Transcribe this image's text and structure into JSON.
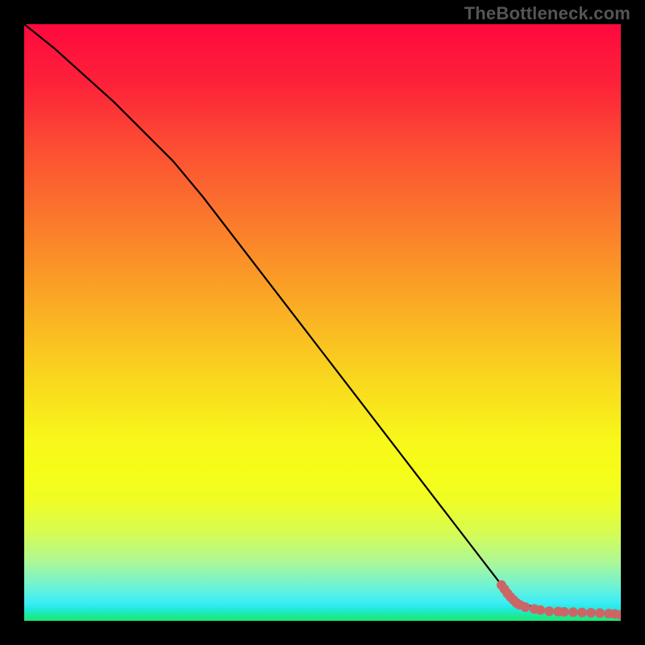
{
  "attribution": "TheBottleneck.com",
  "chart_data": {
    "type": "line",
    "title": "",
    "xlabel": "",
    "ylabel": "",
    "xlim": [
      0,
      100
    ],
    "ylim": [
      0,
      100
    ],
    "grid": false,
    "legend": false,
    "series": [
      {
        "name": "curve",
        "style": "line",
        "color": "#000000",
        "x": [
          0,
          5,
          10,
          15,
          20,
          25,
          30,
          35,
          40,
          45,
          50,
          55,
          60,
          65,
          70,
          75,
          80,
          82,
          84,
          86,
          88,
          90,
          92,
          94,
          96,
          98,
          100
        ],
        "y": [
          100,
          96,
          91.5,
          87,
          82,
          77,
          71,
          64.5,
          58,
          51.5,
          45,
          38.5,
          32,
          25.5,
          19,
          12.5,
          6,
          4,
          2.8,
          2.0,
          1.6,
          1.4,
          1.3,
          1.25,
          1.2,
          1.1,
          1.0
        ]
      },
      {
        "name": "points",
        "style": "scatter",
        "color": "#cc6666",
        "xy": [
          [
            80.0,
            6.0
          ],
          [
            80.5,
            5.3
          ],
          [
            81.0,
            4.6
          ],
          [
            81.5,
            4.0
          ],
          [
            82.0,
            3.5
          ],
          [
            82.5,
            3.0
          ],
          [
            83.0,
            2.7
          ],
          [
            84.0,
            2.3
          ],
          [
            85.5,
            2.0
          ],
          [
            86.5,
            1.8
          ],
          [
            88.0,
            1.6
          ],
          [
            89.5,
            1.55
          ],
          [
            90.5,
            1.5
          ],
          [
            92.0,
            1.45
          ],
          [
            93.5,
            1.4
          ],
          [
            95.0,
            1.35
          ],
          [
            96.5,
            1.3
          ],
          [
            98.0,
            1.2
          ],
          [
            99.0,
            1.15
          ],
          [
            100.0,
            1.0
          ]
        ]
      }
    ],
    "background_gradient": {
      "stops": [
        {
          "pct": 0,
          "color": "#fe093e"
        },
        {
          "pct": 10,
          "color": "#fd2239"
        },
        {
          "pct": 20,
          "color": "#fc4b33"
        },
        {
          "pct": 30,
          "color": "#fb6f2e"
        },
        {
          "pct": 40,
          "color": "#fb9228"
        },
        {
          "pct": 50,
          "color": "#fab623"
        },
        {
          "pct": 60,
          "color": "#f9d91e"
        },
        {
          "pct": 70,
          "color": "#f8f81a"
        },
        {
          "pct": 75,
          "color": "#f6fd18"
        },
        {
          "pct": 80,
          "color": "#effd26"
        },
        {
          "pct": 85,
          "color": "#d8fc50"
        },
        {
          "pct": 90,
          "color": "#aef894"
        },
        {
          "pct": 94,
          "color": "#72f3d2"
        },
        {
          "pct": 97,
          "color": "#3bedf6"
        },
        {
          "pct": 98,
          "color": "#22eae0"
        },
        {
          "pct": 99.3,
          "color": "#1ce98f"
        },
        {
          "pct": 100,
          "color": "#1ce975"
        }
      ]
    }
  }
}
